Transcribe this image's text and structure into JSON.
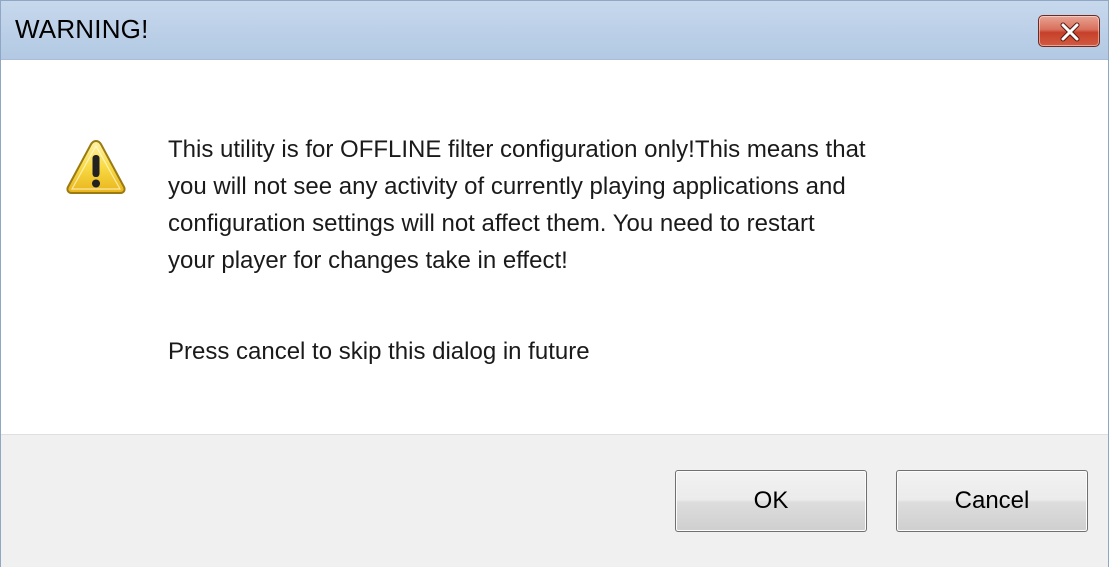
{
  "window": {
    "title": "WARNING!",
    "close_icon": "close-icon"
  },
  "message": {
    "icon": "warning-icon",
    "lines": [
      "This utility is for OFFLINE filter configuration only!This means that",
      "you will not see any activity of currently playing applications and",
      "configuration settings will not affect them. You need to restart",
      "your player for changes take in effect!"
    ],
    "hint": "Press cancel to skip this dialog in future"
  },
  "buttons": {
    "ok_label": "OK",
    "cancel_label": "Cancel"
  },
  "colors": {
    "titlebar": "#bcd0e8",
    "close_button": "#c6402a",
    "footer": "#f0f0f0",
    "warning_yellow": "#f5d13a"
  }
}
